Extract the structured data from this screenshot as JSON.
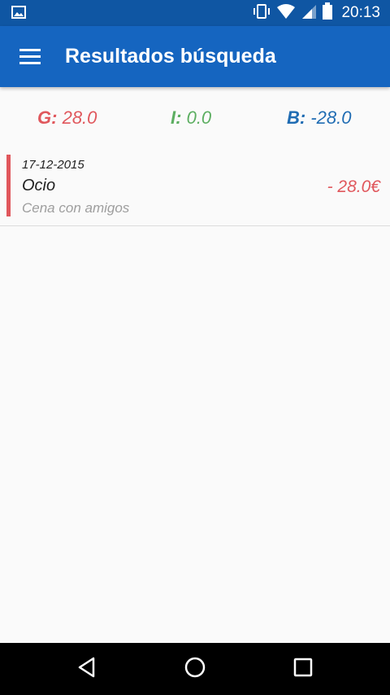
{
  "status_bar": {
    "time": "20:13",
    "icons": [
      "gallery-icon",
      "vibrate-icon",
      "wifi-icon",
      "signal-icon",
      "battery-icon"
    ]
  },
  "app_bar": {
    "title": "Resultados búsqueda",
    "menu_icon": "hamburger-menu-icon",
    "color": "#1565c0"
  },
  "summary": {
    "gastos_label": "G:",
    "gastos_value": "28.0",
    "ingresos_label": "I:",
    "ingresos_value": "0.0",
    "balance_label": "B:",
    "balance_value": "-28.0",
    "colors": {
      "gastos": "#e0575c",
      "ingresos": "#5cae61",
      "balance": "#1f6cb3"
    }
  },
  "results": [
    {
      "date": "17-12-2015",
      "category": "Ocio",
      "description": "Cena con amigos",
      "amount": "- 28.0€",
      "indicator_color": "#e0575c"
    }
  ],
  "nav_bar": {
    "buttons": [
      "back-icon",
      "home-icon",
      "recents-icon"
    ]
  }
}
